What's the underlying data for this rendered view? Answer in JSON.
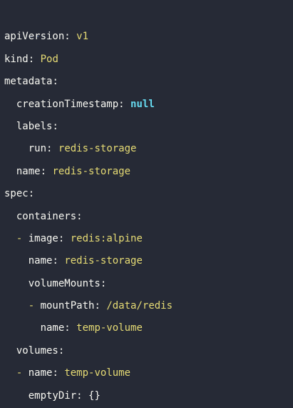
{
  "yaml": {
    "doc_start": "---",
    "lines": [
      {
        "indent": 0,
        "dash": false,
        "key": "apiVersion",
        "value": "v1",
        "value_type": "str"
      },
      {
        "indent": 0,
        "dash": false,
        "key": "kind",
        "value": "Pod",
        "value_type": "str"
      },
      {
        "indent": 0,
        "dash": false,
        "key": "metadata",
        "value": "",
        "value_type": "none"
      },
      {
        "indent": 1,
        "dash": false,
        "key": "creationTimestamp",
        "value": "null",
        "value_type": "null"
      },
      {
        "indent": 1,
        "dash": false,
        "key": "labels",
        "value": "",
        "value_type": "none"
      },
      {
        "indent": 2,
        "dash": false,
        "key": "run",
        "value": "redis-storage",
        "value_type": "str"
      },
      {
        "indent": 1,
        "dash": false,
        "key": "name",
        "value": "redis-storage",
        "value_type": "str"
      },
      {
        "indent": 0,
        "dash": false,
        "key": "spec",
        "value": "",
        "value_type": "none"
      },
      {
        "indent": 1,
        "dash": false,
        "key": "containers",
        "value": "",
        "value_type": "none"
      },
      {
        "indent": 1,
        "dash": true,
        "key": "image",
        "value": "redis:alpine",
        "value_type": "str"
      },
      {
        "indent": 2,
        "dash": false,
        "key": "name",
        "value": "redis-storage",
        "value_type": "str"
      },
      {
        "indent": 2,
        "dash": false,
        "key": "volumeMounts",
        "value": "",
        "value_type": "none"
      },
      {
        "indent": 2,
        "dash": true,
        "key": "mountPath",
        "value": "/data/redis",
        "value_type": "str"
      },
      {
        "indent": 3,
        "dash": false,
        "key": "name",
        "value": "temp-volume",
        "value_type": "str"
      },
      {
        "indent": 1,
        "dash": false,
        "key": "volumes",
        "value": "",
        "value_type": "none"
      },
      {
        "indent": 1,
        "dash": true,
        "key": "name",
        "value": "temp-volume",
        "value_type": "str"
      },
      {
        "indent": 2,
        "dash": false,
        "key": "emptyDir",
        "value": "{}",
        "value_type": "plain"
      }
    ]
  },
  "colors": {
    "background": "#262a36",
    "key": "#f8f8f2",
    "string": "#e6db74",
    "null": "#66d9ef",
    "comment": "#596e9c"
  }
}
